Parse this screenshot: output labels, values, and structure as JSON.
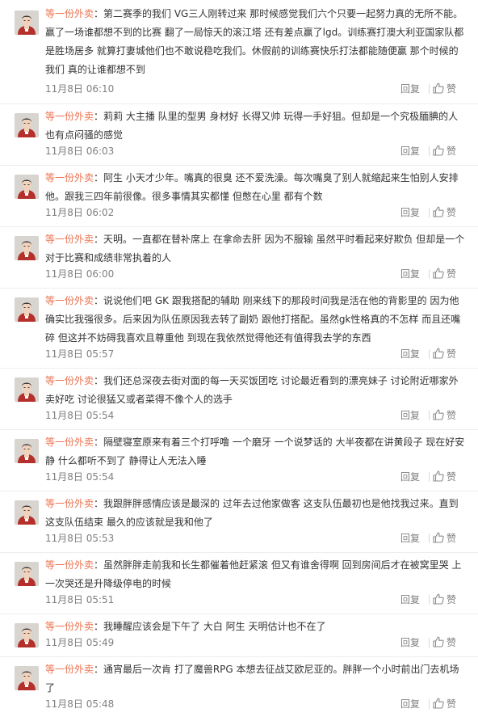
{
  "comments": [
    {
      "author": "等一份外卖",
      "separator": "：",
      "content": "第二赛季的我们 VG三人刚转过来 那时候感觉我们六个只要一起努力真的无所不能。赢了一场谁都想不到的比赛 翻了一局惊天的滚江塔 还有差点赢了lgd。训练赛打澳大利亚国家队都是胜场居多 就算打妻城他们也不敢说稳吃我们。休假前的训练赛快乐打法都能随便赢 那个时候的我们 真的让谁都想不到",
      "time": "11月8日 06:10",
      "reply_label": "回复",
      "like_label": "赞"
    },
    {
      "author": "等一份外卖",
      "separator": "：",
      "content": "莉莉 大主播 队里的型男 身材好 长得又帅 玩得一手好狙。但却是一个究极腼腆的人 也有点闷骚的感觉",
      "time": "11月8日 06:03",
      "reply_label": "回复",
      "like_label": "赞"
    },
    {
      "author": "等一份外卖",
      "separator": "：",
      "content": "阿生 小天才少年。嘴真的很臭 还不爱洗澡。每次嘴臭了别人就缩起来生怕别人安排他。跟我三四年前很像。很多事情其实都懂 但憋在心里 都有个数",
      "time": "11月8日 06:02",
      "reply_label": "回复",
      "like_label": "赞"
    },
    {
      "author": "等一份外卖",
      "separator": "：",
      "content": "天明。一直都在替补席上 在拿命去肝 因为不服输 虽然平时看起来好欺负 但却是一个对于比赛和成绩非常执着的人",
      "time": "11月8日 06:00",
      "reply_label": "回复",
      "like_label": "赞"
    },
    {
      "author": "等一份外卖",
      "separator": "：",
      "content": "说说他们吧 GK 跟我搭配的辅助 刚来线下的那段时间我是活在他的背影里的 因为他确实比我强很多。后来因为队伍原因我去转了副奶 跟他打搭配。虽然gk性格真的不怎样 而且还嘴碎 但这并不妨碍我喜欢且尊重他 到现在我依然觉得他还有值得我去学的东西",
      "time": "11月8日 05:57",
      "reply_label": "回复",
      "like_label": "赞"
    },
    {
      "author": "等一份外卖",
      "separator": "：",
      "content": "我们还总深夜去街对面的每一天买饭团吃 讨论最近看到的漂亮妹子 讨论附近哪家外卖好吃 讨论很猛又或者菜得不像个人的选手",
      "time": "11月8日 05:54",
      "reply_label": "回复",
      "like_label": "赞"
    },
    {
      "author": "等一份外卖",
      "separator": "：",
      "content": "隔壁寝室原来有着三个打呼噜 一个磨牙 一个说梦话的 大半夜都在讲黄段子 现在好安静 什么都听不到了 静得让人无法入睡",
      "time": "11月8日 05:54",
      "reply_label": "回复",
      "like_label": "赞"
    },
    {
      "author": "等一份外卖",
      "separator": "：",
      "content": "我跟胖胖感情应该是最深的 过年去过他家做客 这支队伍最初也是他找我过来。直到这支队伍结束 最久的应该就是我和他了",
      "time": "11月8日 05:53",
      "reply_label": "回复",
      "like_label": "赞"
    },
    {
      "author": "等一份外卖",
      "separator": "：",
      "content": "虽然胖胖走前我和长生都催着他赶紧滚 但又有谁舍得啊 回到房间后才在被窝里哭 上一次哭还是升降级停电的时候",
      "time": "11月8日 05:51",
      "reply_label": "回复",
      "like_label": "赞"
    },
    {
      "author": "等一份外卖",
      "separator": "：",
      "content": "我睡醒应该会是下午了 大白 阿生 天明估计也不在了",
      "time": "11月8日 05:49",
      "reply_label": "回复",
      "like_label": "赞"
    },
    {
      "author": "等一份外卖",
      "separator": "：",
      "content": "通宵最后一次肯 打了魔兽RPG 本想去征战艾欧尼亚的。胖胖一个小时前出门去机场了",
      "time": "11月8日 05:48",
      "reply_label": "回复",
      "like_label": "赞"
    }
  ],
  "colors": {
    "author": "#eb7350",
    "text": "#333333",
    "meta": "#808080",
    "divider": "#eeeeee"
  },
  "icons": {
    "avatar": "avatar-portrait",
    "like": "thumbs-up-icon"
  }
}
